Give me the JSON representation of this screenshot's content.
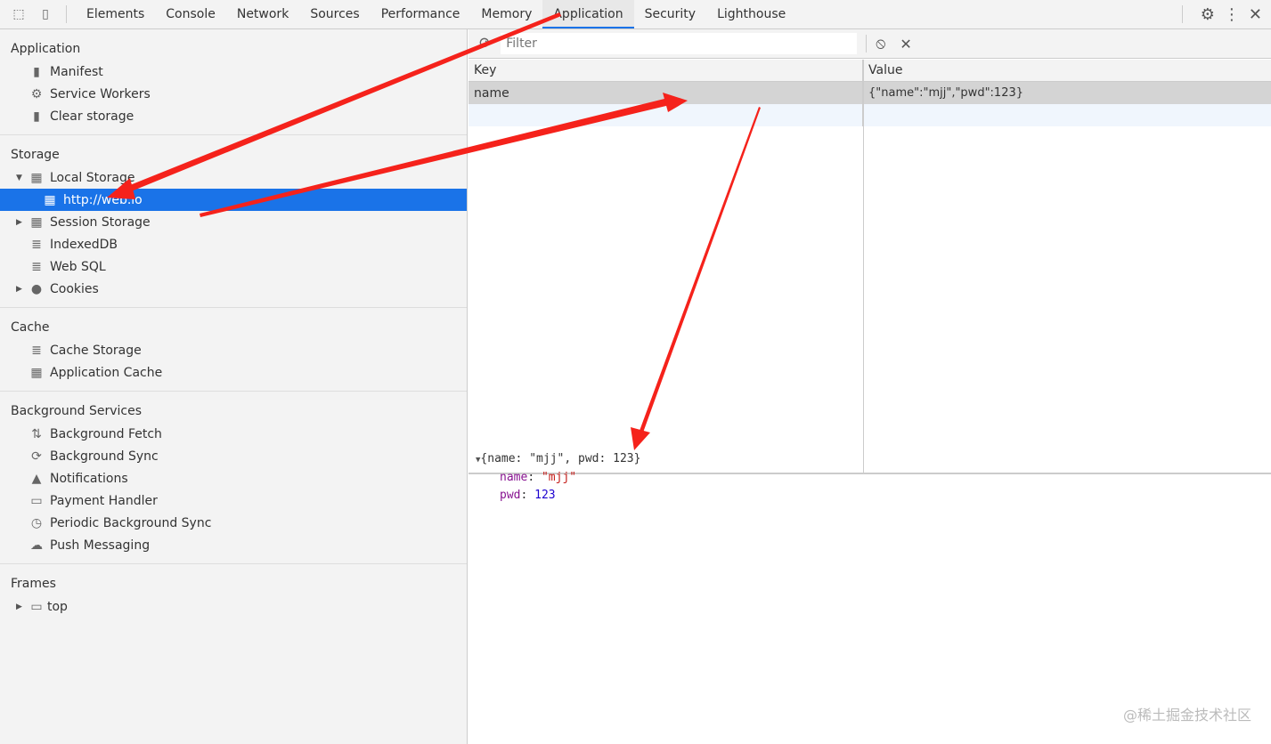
{
  "toolbar": {
    "tabs": [
      "Elements",
      "Console",
      "Network",
      "Sources",
      "Performance",
      "Memory",
      "Application",
      "Security",
      "Lighthouse"
    ],
    "active": "Application"
  },
  "sidebar": {
    "application": {
      "title": "Application",
      "items": [
        "Manifest",
        "Service Workers",
        "Clear storage"
      ]
    },
    "storage": {
      "title": "Storage",
      "items": [
        "Local Storage",
        "http://web.io",
        "Session Storage",
        "IndexedDB",
        "Web SQL",
        "Cookies"
      ]
    },
    "cache": {
      "title": "Cache",
      "items": [
        "Cache Storage",
        "Application Cache"
      ]
    },
    "background": {
      "title": "Background Services",
      "items": [
        "Background Fetch",
        "Background Sync",
        "Notifications",
        "Payment Handler",
        "Periodic Background Sync",
        "Push Messaging"
      ]
    },
    "frames": {
      "title": "Frames",
      "items": [
        "top"
      ]
    }
  },
  "filter": {
    "placeholder": "Filter"
  },
  "table": {
    "headers": [
      "Key",
      "Value"
    ],
    "rows": [
      {
        "key": "name",
        "value": "{\"name\":\"mjj\",\"pwd\":123}"
      }
    ]
  },
  "preview": {
    "summary": "{name: \"mjj\", pwd: 123}",
    "props": [
      {
        "key": "name",
        "value": "\"mjj\""
      },
      {
        "key": "pwd",
        "value": "123"
      }
    ]
  },
  "watermark": "@稀土掘金技术社区",
  "colors": {
    "accent": "#1a73e8",
    "arrow": "#f5221b"
  }
}
